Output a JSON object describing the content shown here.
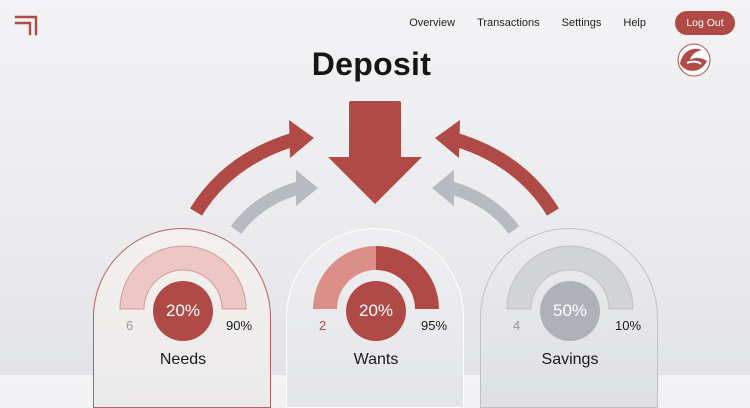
{
  "nav": {
    "items": [
      "Overview",
      "Transactions",
      "Settings",
      "Help"
    ],
    "logout_label": "Log Out"
  },
  "page": {
    "title": "Deposit"
  },
  "cards": [
    {
      "name": "Needs",
      "percent": "20%",
      "left_value": "6",
      "right_value": "90%",
      "gauge_fill": 0
    },
    {
      "name": "Wants",
      "percent": "20%",
      "left_value": "2",
      "right_value": "95%",
      "gauge_fill": 0.5
    },
    {
      "name": "Savings",
      "percent": "50%",
      "left_value": "4",
      "right_value": "10%",
      "gauge_fill": 0
    }
  ],
  "colors": {
    "accent": "#b04a46",
    "accent_light": "#e1a7a2",
    "grey": "#b7bac0",
    "grey_light": "#d1d3d7",
    "grey_center": "#aeb1b7"
  },
  "icons": {
    "logo": "brand-logo-icon",
    "avatar": "user-avatar-icon",
    "deposit": "down-arrow-icon"
  }
}
